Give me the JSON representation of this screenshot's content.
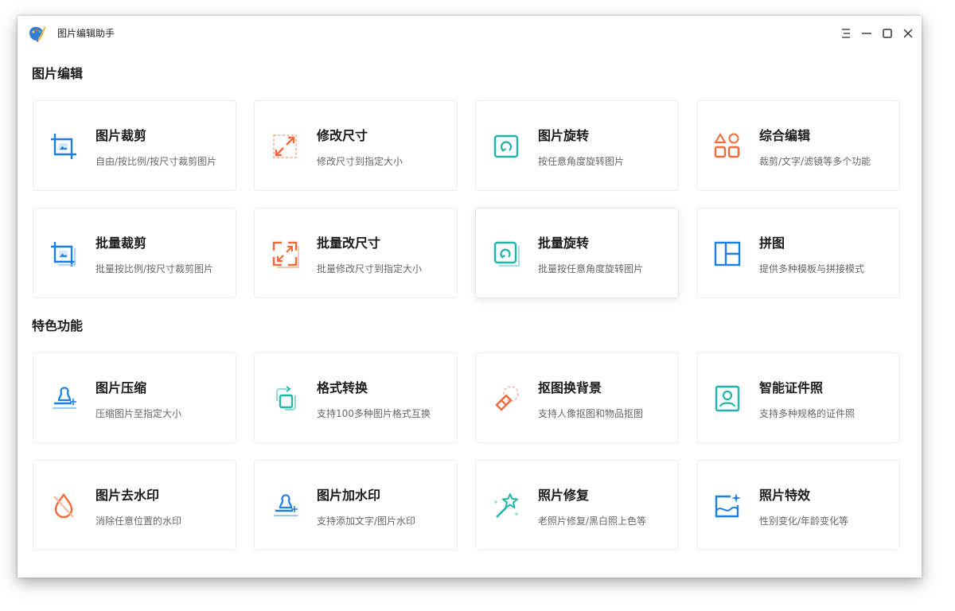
{
  "app": {
    "title": "图片编辑助手",
    "logo_icon": "paint-brush-palette-icon",
    "controls": [
      "menu-icon",
      "minimize-icon",
      "maximize-icon",
      "close-icon"
    ]
  },
  "sections": [
    {
      "title": "图片编辑",
      "cards": [
        {
          "title": "图片裁剪",
          "desc": "自由/按比例/按尺寸裁剪图片",
          "icon": "crop-icon"
        },
        {
          "title": "修改尺寸",
          "desc": "修改尺寸到指定大小",
          "icon": "resize-icon"
        },
        {
          "title": "图片旋转",
          "desc": "按任意角度旋转图片",
          "icon": "rotate-icon"
        },
        {
          "title": "综合编辑",
          "desc": "裁剪/文字/滤镜等多个功能",
          "icon": "shapes-icon"
        },
        {
          "title": "批量裁剪",
          "desc": "批量按比例/按尺寸裁剪图片",
          "icon": "batch-crop-icon"
        },
        {
          "title": "批量改尺寸",
          "desc": "批量修改尺寸到指定大小",
          "icon": "batch-resize-icon"
        },
        {
          "title": "批量旋转",
          "desc": "批量按任意角度旋转图片",
          "icon": "batch-rotate-icon"
        },
        {
          "title": "拼图",
          "desc": "提供多种模板与拼接模式",
          "icon": "collage-icon"
        }
      ]
    },
    {
      "title": "特色功能",
      "cards": [
        {
          "title": "图片压缩",
          "desc": "压缩图片至指定大小",
          "icon": "compress-stamp-icon"
        },
        {
          "title": "格式转换",
          "desc": "支持100多种图片格式互换",
          "icon": "format-convert-icon"
        },
        {
          "title": "抠图换背景",
          "desc": "支持人像抠图和物品抠图",
          "icon": "eraser-icon"
        },
        {
          "title": "智能证件照",
          "desc": "支持多种规格的证件照",
          "icon": "id-photo-icon"
        },
        {
          "title": "图片去水印",
          "desc": "消除任意位置的水印",
          "icon": "remove-watermark-icon"
        },
        {
          "title": "图片加水印",
          "desc": "支持添加文字/图片水印",
          "icon": "add-watermark-icon"
        },
        {
          "title": "照片修复",
          "desc": "老照片修复/黑白照上色等",
          "icon": "magic-wand-icon"
        },
        {
          "title": "照片特效",
          "desc": "性别变化/年龄变化等",
          "icon": "image-sparkle-icon"
        }
      ]
    }
  ],
  "colors": {
    "blue": "#1b7fe3",
    "orange": "#f26a3a",
    "teal": "#1fb5a8",
    "text": "#1a1a1a",
    "desc": "#666666"
  }
}
